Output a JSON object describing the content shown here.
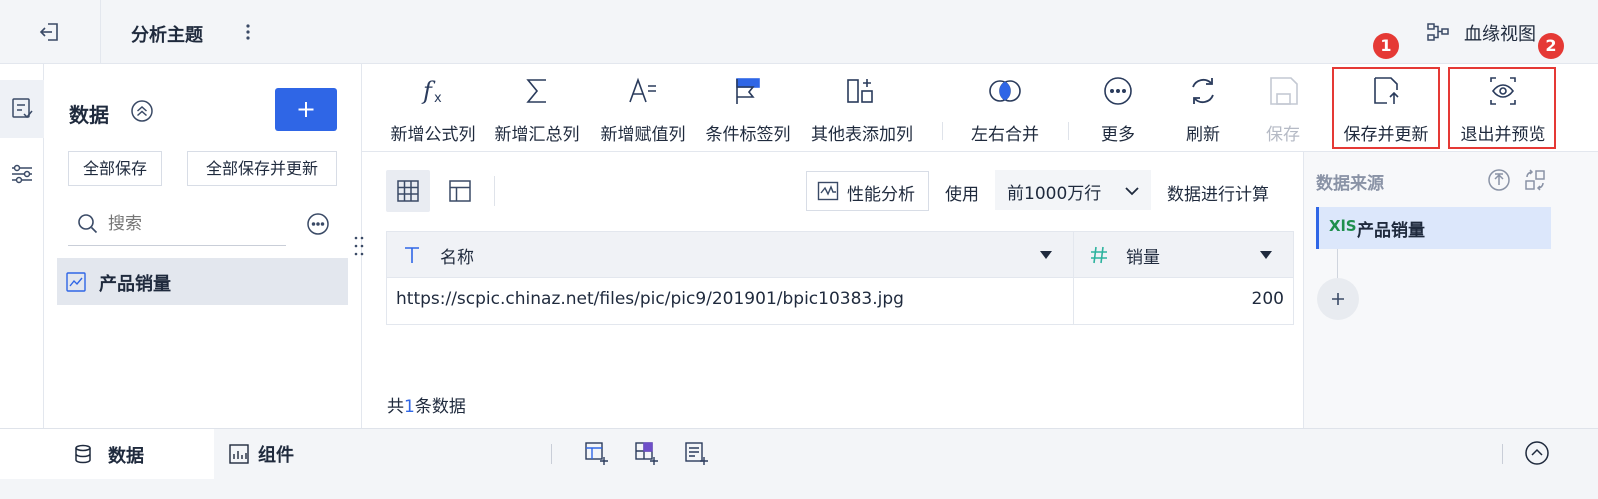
{
  "header": {
    "title": "分析主题",
    "lineage_label": "血缘视图"
  },
  "left_panel": {
    "title": "数据",
    "save_all": "全部保存",
    "save_all_update": "全部保存并更新",
    "search_placeholder": "搜索",
    "dataset_name": "产品销量"
  },
  "toolbar": {
    "items": [
      "新增公式列",
      "新增汇总列",
      "新增赋值列",
      "条件标签列",
      "其他表添加列",
      "左右合并",
      "更多",
      "刷新",
      "保存",
      "保存并更新",
      "退出并预览"
    ]
  },
  "badges": [
    "1",
    "2"
  ],
  "table_toolbar": {
    "perf_label": "性能分析",
    "use_label": "使用",
    "rows_select": "前1000万行",
    "calc_label": "数据进行计算"
  },
  "table": {
    "columns": [
      "名称",
      "销量"
    ],
    "rows": [
      [
        "https://scpic.chinaz.net/files/pic/pic9/201901/bpic10383.jpg",
        "200"
      ]
    ]
  },
  "footer_count": {
    "prefix": "共",
    "count": "1",
    "suffix": "条数据"
  },
  "right_panel": {
    "title": "数据来源",
    "source_name": "产品销量",
    "source_tag": "XlS"
  },
  "bottom_bar": {
    "tab_data": "数据",
    "tab_component": "组件"
  },
  "colors": {
    "accent": "#2f66e6",
    "highlight_red": "#e53935",
    "sidebar_bg": "#f3f5f8"
  }
}
